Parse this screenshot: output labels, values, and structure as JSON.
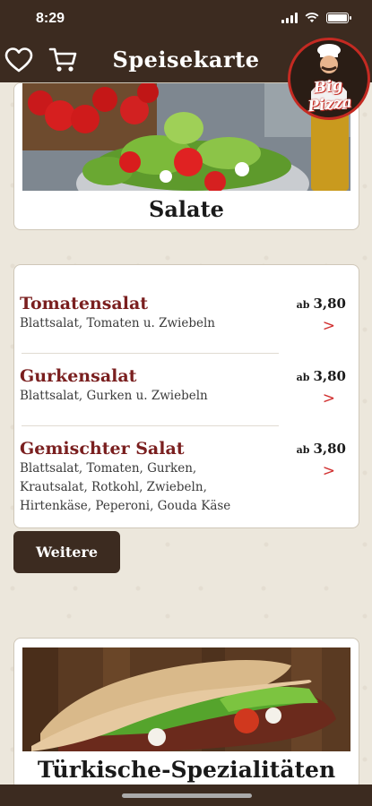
{
  "status": {
    "time": "8:29"
  },
  "nav": {
    "title": "Speisekarte"
  },
  "logo": {
    "text": "Big Pizza"
  },
  "top_category": {
    "title": "Salate"
  },
  "menu_items": [
    {
      "name": "Tomatensalat",
      "description": "Blattsalat, Tomaten u. Zwiebeln",
      "price_prefix": "ab",
      "price": "3,80",
      "arrow": ">"
    },
    {
      "name": "Gurkensalat",
      "description": "Blattsalat, Gurken u. Zwiebeln",
      "price_prefix": "ab",
      "price": "3,80",
      "arrow": ">"
    },
    {
      "name": "Gemischter Salat",
      "description": "Blattsalat, Tomaten, Gurken, Krautsalat, Rotkohl, Zwiebeln, Hirtenkäse, Peperoni, Gouda Käse",
      "price_prefix": "ab",
      "price": "3,80",
      "arrow": ">"
    }
  ],
  "more_button": {
    "label": "Weitere"
  },
  "bottom_category": {
    "title": "Türkische-Spezialitäten"
  },
  "colors": {
    "brand_brown": "#3c2b20",
    "item_red": "#7a1f1f",
    "arrow_red": "#d12f2f",
    "logo_red": "#c42a22"
  },
  "icons": {
    "favorites": "heart-icon",
    "cart": "cart-icon"
  }
}
